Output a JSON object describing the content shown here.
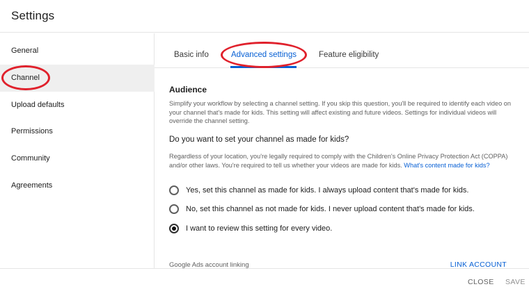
{
  "window": {
    "title": "Settings"
  },
  "sidebar": {
    "items": [
      {
        "label": "General"
      },
      {
        "label": "Channel"
      },
      {
        "label": "Upload defaults"
      },
      {
        "label": "Permissions"
      },
      {
        "label": "Community"
      },
      {
        "label": "Agreements"
      }
    ],
    "active_index": 1
  },
  "tabs": [
    {
      "label": "Basic info"
    },
    {
      "label": "Advanced settings"
    },
    {
      "label": "Feature eligibility"
    }
  ],
  "active_tab_index": 1,
  "audience": {
    "title": "Audience",
    "description": "Simplify your workflow by selecting a channel setting. If you skip this question, you'll be required to identify each video on your channel that's made for kids. This setting will affect existing and future videos. Settings for individual videos will override the channel setting.",
    "question": "Do you want to set your channel as made for kids?",
    "legal_text": "Regardless of your location, you're legally required to comply with the Children's Online Privacy Protection Act (COPPA) and/or other laws. You're required to tell us whether your videos are made for kids.",
    "legal_link": "What's content made for kids?",
    "options": [
      {
        "label": "Yes, set this channel as made for kids. I always upload content that's made for kids.",
        "checked": false
      },
      {
        "label": "No, set this channel as not made for kids. I never upload content that's made for kids.",
        "checked": false
      },
      {
        "label": "I want to review this setting for every video.",
        "checked": true
      }
    ]
  },
  "google_ads": {
    "label": "Google Ads account linking",
    "action_label": "LINK ACCOUNT"
  },
  "footer": {
    "close_label": "CLOSE",
    "save_label": "SAVE"
  },
  "colors": {
    "accent": "#065fd4",
    "annotation": "#e0212c"
  }
}
